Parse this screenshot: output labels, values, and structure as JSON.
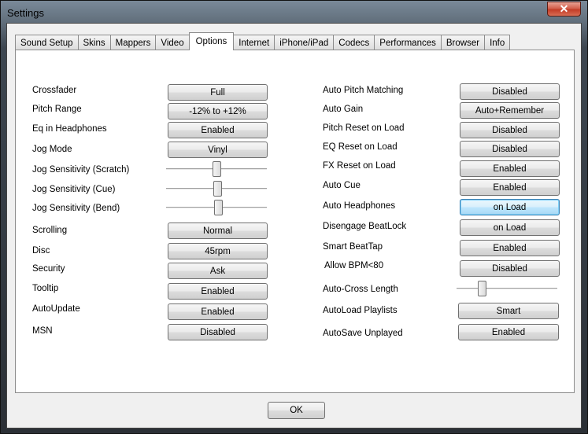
{
  "window": {
    "title": "Settings",
    "close_label": "✕"
  },
  "tabs": [
    {
      "label": "Sound Setup",
      "active": false
    },
    {
      "label": "Skins",
      "active": false
    },
    {
      "label": "Mappers",
      "active": false
    },
    {
      "label": "Video",
      "active": false
    },
    {
      "label": "Options",
      "active": true
    },
    {
      "label": "Internet",
      "active": false
    },
    {
      "label": "iPhone/iPad",
      "active": false
    },
    {
      "label": "Codecs",
      "active": false
    },
    {
      "label": "Performances",
      "active": false
    },
    {
      "label": "Browser",
      "active": false
    },
    {
      "label": "Info",
      "active": false
    }
  ],
  "left": {
    "crossfader": {
      "label": "Crossfader",
      "value": "Full"
    },
    "pitch_range": {
      "label": "Pitch Range",
      "value": "-12% to +12%"
    },
    "eq_headphones": {
      "label": "Eq in Headphones",
      "value": "Enabled"
    },
    "jog_mode": {
      "label": "Jog Mode",
      "value": "Vinyl"
    },
    "jog_scratch": {
      "label": "Jog Sensitivity (Scratch)",
      "level": 0.5
    },
    "jog_cue": {
      "label": "Jog Sensitivity (Cue)",
      "level": 0.51
    },
    "jog_bend": {
      "label": "Jog Sensitivity (Bend)",
      "level": 0.52
    },
    "scrolling": {
      "label": "Scrolling",
      "value": "Normal"
    },
    "disc": {
      "label": "Disc",
      "value": "45rpm"
    },
    "security": {
      "label": "Security",
      "value": "Ask"
    },
    "tooltip": {
      "label": "Tooltip",
      "value": "Enabled"
    },
    "autoupdate": {
      "label": "AutoUpdate",
      "value": "Enabled"
    },
    "msn": {
      "label": "MSN",
      "value": "Disabled"
    }
  },
  "right": {
    "auto_pitch": {
      "label": "Auto Pitch Matching",
      "value": "Disabled"
    },
    "auto_gain": {
      "label": "Auto Gain",
      "value": "Auto+Remember"
    },
    "pitch_reset": {
      "label": "Pitch Reset on Load",
      "value": "Disabled"
    },
    "eq_reset": {
      "label": "EQ Reset on Load",
      "value": "Disabled"
    },
    "fx_reset": {
      "label": "FX Reset on Load",
      "value": "Enabled"
    },
    "auto_cue": {
      "label": "Auto Cue",
      "value": "Enabled"
    },
    "auto_headphones": {
      "label": "Auto Headphones",
      "value": "on Load"
    },
    "disengage_beatlock": {
      "label": "Disengage BeatLock",
      "value": "on Load"
    },
    "smart_beattap": {
      "label": "Smart BeatTap",
      "value": "Enabled"
    },
    "allow_bpm": {
      "label": "Allow BPM<80",
      "value": "Disabled"
    },
    "autocross": {
      "label": "Auto-Cross Length",
      "level": 0.23
    },
    "autoload": {
      "label": "AutoLoad Playlists",
      "value": "Smart"
    },
    "autosave": {
      "label": "AutoSave Unplayed",
      "value": "Enabled"
    }
  },
  "footer": {
    "ok_label": "OK"
  }
}
